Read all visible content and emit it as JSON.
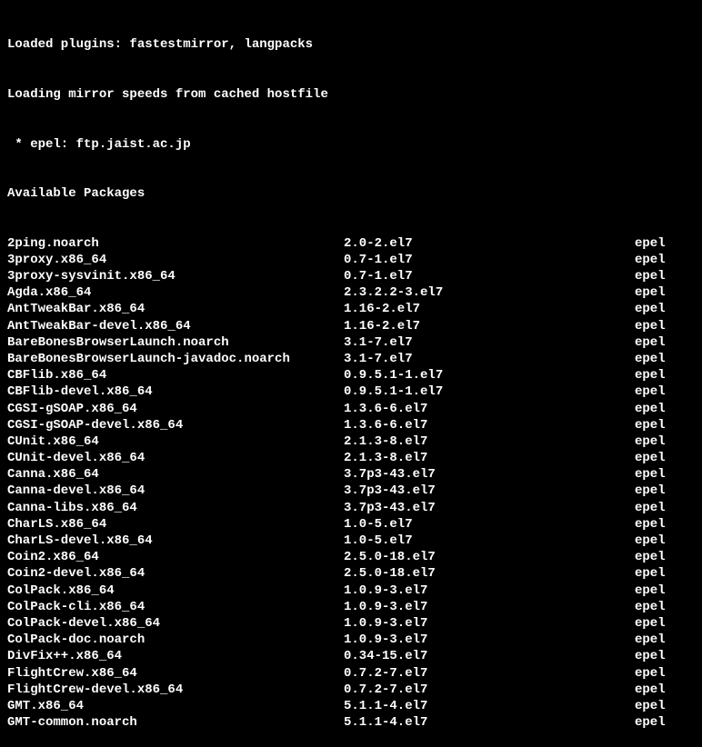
{
  "header": {
    "line1": "Loaded plugins: fastestmirror, langpacks",
    "line2": "Loading mirror speeds from cached hostfile",
    "line3": " * epel: ftp.jaist.ac.jp",
    "line4": "Available Packages"
  },
  "packages": [
    {
      "name": "2ping.noarch",
      "version": "2.0-2.el7",
      "repo": "epel"
    },
    {
      "name": "3proxy.x86_64",
      "version": "0.7-1.el7",
      "repo": "epel"
    },
    {
      "name": "3proxy-sysvinit.x86_64",
      "version": "0.7-1.el7",
      "repo": "epel"
    },
    {
      "name": "Agda.x86_64",
      "version": "2.3.2.2-3.el7",
      "repo": "epel"
    },
    {
      "name": "AntTweakBar.x86_64",
      "version": "1.16-2.el7",
      "repo": "epel"
    },
    {
      "name": "AntTweakBar-devel.x86_64",
      "version": "1.16-2.el7",
      "repo": "epel"
    },
    {
      "name": "BareBonesBrowserLaunch.noarch",
      "version": "3.1-7.el7",
      "repo": "epel"
    },
    {
      "name": "BareBonesBrowserLaunch-javadoc.noarch",
      "version": "3.1-7.el7",
      "repo": "epel"
    },
    {
      "name": "CBFlib.x86_64",
      "version": "0.9.5.1-1.el7",
      "repo": "epel"
    },
    {
      "name": "CBFlib-devel.x86_64",
      "version": "0.9.5.1-1.el7",
      "repo": "epel"
    },
    {
      "name": "CGSI-gSOAP.x86_64",
      "version": "1.3.6-6.el7",
      "repo": "epel"
    },
    {
      "name": "CGSI-gSOAP-devel.x86_64",
      "version": "1.3.6-6.el7",
      "repo": "epel"
    },
    {
      "name": "CUnit.x86_64",
      "version": "2.1.3-8.el7",
      "repo": "epel"
    },
    {
      "name": "CUnit-devel.x86_64",
      "version": "2.1.3-8.el7",
      "repo": "epel"
    },
    {
      "name": "Canna.x86_64",
      "version": "3.7p3-43.el7",
      "repo": "epel"
    },
    {
      "name": "Canna-devel.x86_64",
      "version": "3.7p3-43.el7",
      "repo": "epel"
    },
    {
      "name": "Canna-libs.x86_64",
      "version": "3.7p3-43.el7",
      "repo": "epel"
    },
    {
      "name": "CharLS.x86_64",
      "version": "1.0-5.el7",
      "repo": "epel"
    },
    {
      "name": "CharLS-devel.x86_64",
      "version": "1.0-5.el7",
      "repo": "epel"
    },
    {
      "name": "Coin2.x86_64",
      "version": "2.5.0-18.el7",
      "repo": "epel"
    },
    {
      "name": "Coin2-devel.x86_64",
      "version": "2.5.0-18.el7",
      "repo": "epel"
    },
    {
      "name": "ColPack.x86_64",
      "version": "1.0.9-3.el7",
      "repo": "epel"
    },
    {
      "name": "ColPack-cli.x86_64",
      "version": "1.0.9-3.el7",
      "repo": "epel"
    },
    {
      "name": "ColPack-devel.x86_64",
      "version": "1.0.9-3.el7",
      "repo": "epel"
    },
    {
      "name": "ColPack-doc.noarch",
      "version": "1.0.9-3.el7",
      "repo": "epel"
    },
    {
      "name": "DivFix++.x86_64",
      "version": "0.34-15.el7",
      "repo": "epel"
    },
    {
      "name": "FlightCrew.x86_64",
      "version": "0.7.2-7.el7",
      "repo": "epel"
    },
    {
      "name": "FlightCrew-devel.x86_64",
      "version": "0.7.2-7.el7",
      "repo": "epel"
    },
    {
      "name": "GMT.x86_64",
      "version": "5.1.1-4.el7",
      "repo": "epel"
    },
    {
      "name": "GMT-common.noarch",
      "version": "5.1.1-4.el7",
      "repo": "epel"
    }
  ]
}
